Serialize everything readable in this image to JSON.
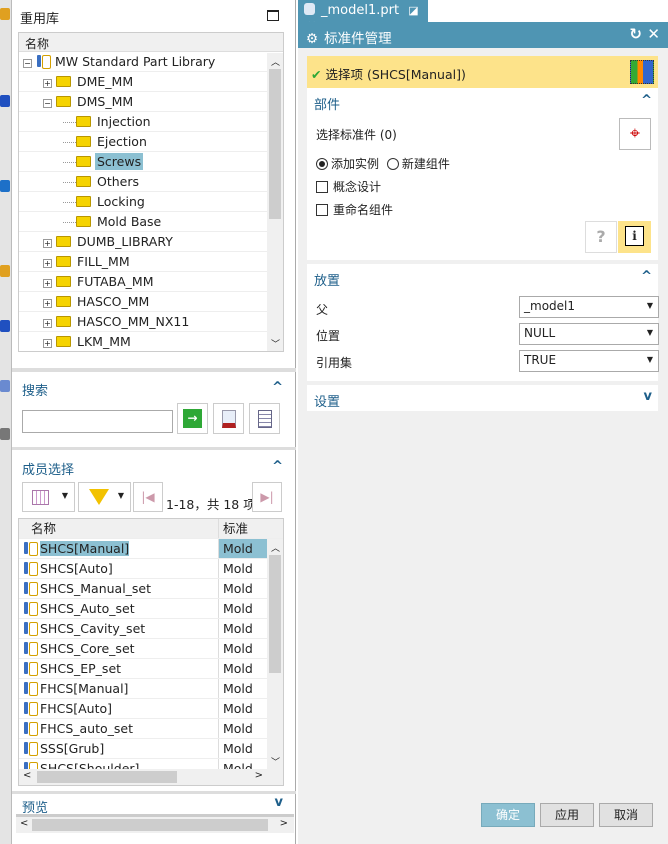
{
  "left": {
    "title": "重用库",
    "tree": {
      "header": "名称",
      "items": [
        {
          "label": "MW Standard Part Library",
          "level": 0,
          "expander": "-",
          "icon": "library-icon"
        },
        {
          "label": "DME_MM",
          "level": 1,
          "expander": "+"
        },
        {
          "label": "DMS_MM",
          "level": 1,
          "expander": "-"
        },
        {
          "label": "Injection",
          "level": 2
        },
        {
          "label": "Ejection",
          "level": 2
        },
        {
          "label": "Screws",
          "level": 2,
          "selected": true
        },
        {
          "label": "Others",
          "level": 2
        },
        {
          "label": "Locking",
          "level": 2
        },
        {
          "label": "Mold Base",
          "level": 2
        },
        {
          "label": "DUMB_LIBRARY",
          "level": 1,
          "expander": "+"
        },
        {
          "label": "FILL_MM",
          "level": 1,
          "expander": "+"
        },
        {
          "label": "FUTABA_MM",
          "level": 1,
          "expander": "+"
        },
        {
          "label": "HASCO_MM",
          "level": 1,
          "expander": "+"
        },
        {
          "label": "HASCO_MM_NX11",
          "level": 1,
          "expander": "+"
        },
        {
          "label": "LKM_MM",
          "level": 1,
          "expander": "+"
        }
      ]
    },
    "search": {
      "title": "搜索",
      "value": "",
      "placeholder": ""
    },
    "members": {
      "title": "成员选择",
      "pager": "1-18，共 18 项",
      "columns": [
        "名称",
        "标准"
      ],
      "rows": [
        [
          "SHCS[Manual]",
          "Mold "
        ],
        [
          "SHCS[Auto]",
          "Mold "
        ],
        [
          "SHCS_Manual_set",
          "Mold "
        ],
        [
          "SHCS_Auto_set",
          "Mold "
        ],
        [
          "SHCS_Cavity_set",
          "Mold "
        ],
        [
          "SHCS_Core_set",
          "Mold "
        ],
        [
          "SHCS_EP_set",
          "Mold "
        ],
        [
          "FHCS[Manual]",
          "Mold "
        ],
        [
          "FHCS[Auto]",
          "Mold "
        ],
        [
          "FHCS_auto_set",
          "Mold "
        ],
        [
          "SSS[Grub]",
          "Mold "
        ],
        [
          "SHCS[Shoulder]",
          "Mold "
        ]
      ]
    },
    "preview": {
      "title": "预览"
    }
  },
  "right": {
    "tab": "_model1.prt",
    "dialog_title": "标准件管理",
    "select_item": "选择项 (SHCS[Manual])",
    "part": {
      "title": "部件",
      "select_std": "选择标准件 (0)",
      "radio_add": "添加实例",
      "radio_new": "新建组件",
      "radio_selected": "添加实例",
      "concept": "概念设计",
      "concept_checked": false,
      "rename": "重命名组件",
      "rename_checked": false
    },
    "placement": {
      "title": "放置",
      "parent_label": "父",
      "parent": "_model1",
      "position_label": "位置",
      "position": "NULL",
      "refset_label": "引用集",
      "refset": "TRUE"
    },
    "settings": {
      "title": "设置"
    },
    "buttons": {
      "ok": "确定",
      "apply": "应用",
      "cancel": "取消"
    }
  },
  "colors": {
    "accent": "#4f95b3",
    "selection": "#8cc0d2",
    "highlight": "#fde38a",
    "section_title": "#1e5f8a"
  }
}
